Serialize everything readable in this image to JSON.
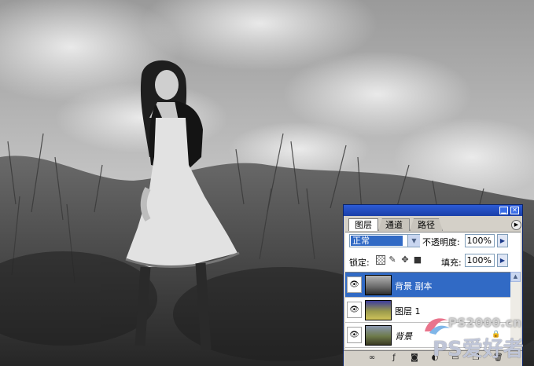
{
  "panel": {
    "tabs": [
      {
        "label": "图层",
        "active": true
      },
      {
        "label": "通道",
        "active": false
      },
      {
        "label": "路径",
        "active": false
      }
    ],
    "blend_mode": "正常",
    "opacity_label": "不透明度:",
    "opacity_value": "100%",
    "lock_label": "锁定:",
    "fill_label": "填充:",
    "fill_value": "100%",
    "layers": [
      {
        "name": "背景 副本",
        "selected": true,
        "visible": true
      },
      {
        "name": "图层 1",
        "selected": false,
        "visible": true
      },
      {
        "name": "背景",
        "selected": false,
        "visible": true,
        "locked": true
      }
    ],
    "colors": {
      "selection": "#316ac5",
      "titlebar": "#1a3fa8",
      "panel_bg": "#d4d0c8"
    }
  },
  "watermark": {
    "site": "PS2000.cn",
    "brand": "PS爱好者"
  },
  "icons": {
    "minimize": "minimize-icon",
    "close": "close-icon",
    "eye": "eye-icon",
    "lock": "lock-icon"
  }
}
